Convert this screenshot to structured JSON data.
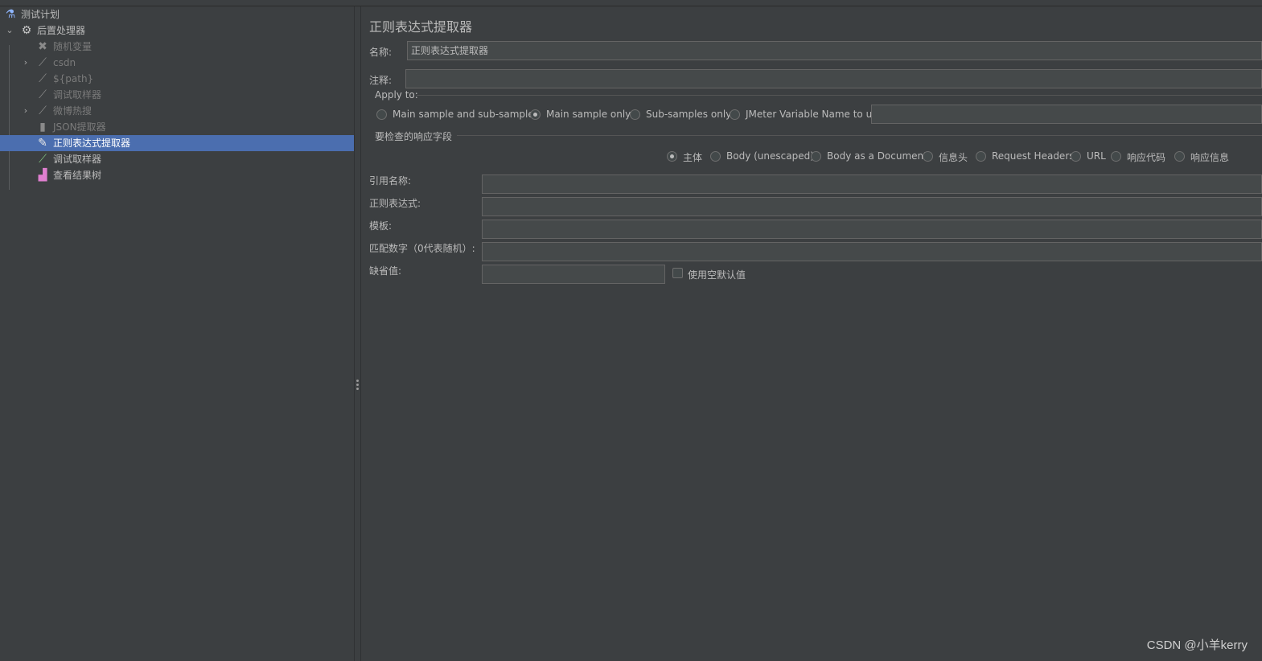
{
  "tree": {
    "items": [
      {
        "label": "测试计划"
      },
      {
        "label": "后置处理器"
      },
      {
        "label": "随机变量"
      },
      {
        "label": "csdn"
      },
      {
        "label": "${path}"
      },
      {
        "label": "调试取样器"
      },
      {
        "label": "微博热搜"
      },
      {
        "label": "JSON提取器"
      },
      {
        "label": "正则表达式提取器"
      },
      {
        "label": "调试取样器"
      },
      {
        "label": "查看结果树"
      }
    ]
  },
  "panel": {
    "title": "正则表达式提取器",
    "name_label": "名称:",
    "name_value": "正则表达式提取器",
    "comment_label": "注释:",
    "comment_value": "",
    "apply_to": {
      "legend": "Apply to:",
      "options": [
        "Main sample and sub-samples",
        "Main sample only",
        "Sub-samples only",
        "JMeter Variable Name to use"
      ],
      "selected": "Main sample only",
      "variable_value": ""
    },
    "field_to_check": {
      "legend": "要检查的响应字段",
      "options": [
        "主体",
        "Body (unescaped)",
        "Body as a Document",
        "信息头",
        "Request Headers",
        "URL",
        "响应代码",
        "响应信息"
      ],
      "selected": "主体"
    },
    "ref_name_label": "引用名称:",
    "ref_name_value": "",
    "regex_label": "正则表达式:",
    "regex_value": "",
    "template_label": "模板:",
    "template_value": "",
    "match_no_label": "匹配数字（0代表随机）:",
    "match_no_value": "",
    "default_label": "缺省值:",
    "default_value": "",
    "use_empty_label": "使用空默认值",
    "use_empty_checked": false
  },
  "watermark": "CSDN @小羊kerry",
  "colors": {
    "selection": "#4b6eaf",
    "background": "#3c3f41",
    "field": "#45494a"
  }
}
